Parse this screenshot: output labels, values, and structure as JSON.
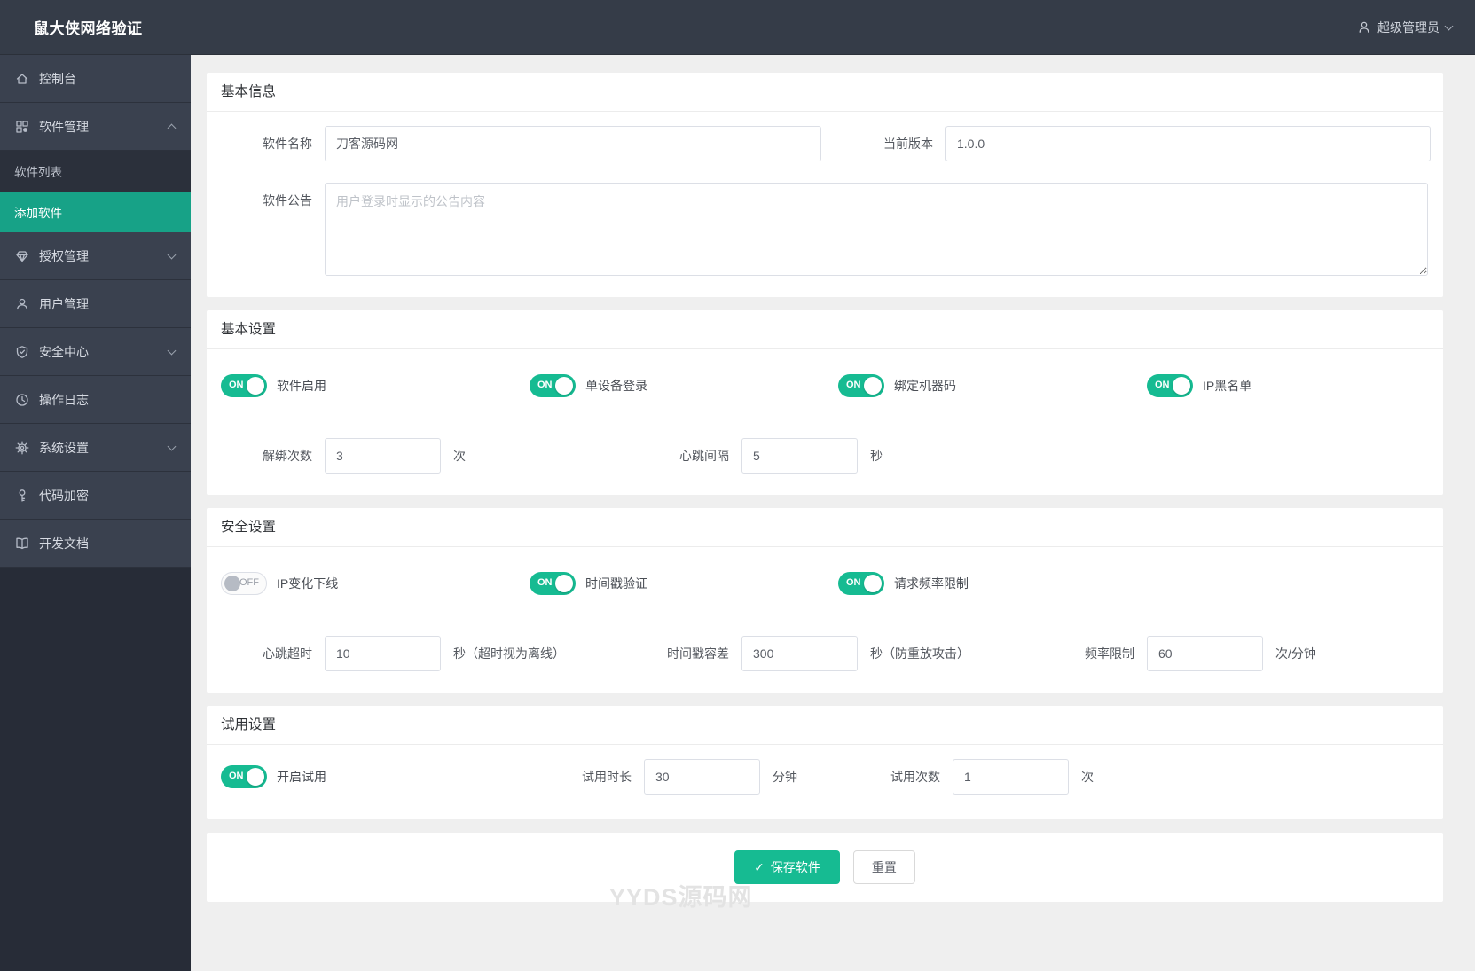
{
  "header": {
    "logo": "鼠大侠网络验证",
    "user": "超级管理员"
  },
  "ui": {
    "on_label": "ON",
    "off_label": "OFF",
    "check_icon": "✓"
  },
  "sidebar": {
    "items": [
      {
        "label": "控制台",
        "icon": "home"
      },
      {
        "label": "软件管理",
        "icon": "apps",
        "expanded": true
      },
      {
        "label": "软件列表",
        "submenu_of": "软件管理"
      },
      {
        "label": "添加软件",
        "submenu_of": "软件管理",
        "active": true
      },
      {
        "label": "授权管理",
        "icon": "gem",
        "expanded": false
      },
      {
        "label": "用户管理",
        "icon": "user"
      },
      {
        "label": "安全中心",
        "icon": "shield",
        "expanded": false
      },
      {
        "label": "操作日志",
        "icon": "clock"
      },
      {
        "label": "系统设置",
        "icon": "gear",
        "expanded": false
      },
      {
        "label": "代码加密",
        "icon": "key"
      },
      {
        "label": "开发文档",
        "icon": "book"
      }
    ]
  },
  "basic_info": {
    "title": "基本信息",
    "name": {
      "label": "软件名称",
      "value": "刀客源码网"
    },
    "version": {
      "label": "当前版本",
      "value": "1.0.0"
    },
    "notice": {
      "label": "软件公告",
      "placeholder": "用户登录时显示的公告内容"
    }
  },
  "basic_settings": {
    "title": "基本设置",
    "toggles": [
      {
        "label": "软件启用",
        "state": "on"
      },
      {
        "label": "单设备登录",
        "state": "on"
      },
      {
        "label": "绑定机器码",
        "state": "on"
      },
      {
        "label": "IP黑名单",
        "state": "on"
      }
    ],
    "unbind": {
      "label": "解绑次数",
      "value": "3",
      "suffix": "次"
    },
    "heartbeat": {
      "label": "心跳间隔",
      "value": "5",
      "suffix": "秒"
    }
  },
  "security_settings": {
    "title": "安全设置",
    "toggles": [
      {
        "label": "IP变化下线",
        "state": "off"
      },
      {
        "label": "时间戳验证",
        "state": "on"
      },
      {
        "label": "请求频率限制",
        "state": "on"
      }
    ],
    "timeout": {
      "label": "心跳超时",
      "value": "10",
      "suffix": "秒（超时视为离线）"
    },
    "tolerance": {
      "label": "时间戳容差",
      "value": "300",
      "suffix": "秒（防重放攻击）"
    },
    "rate": {
      "label": "频率限制",
      "value": "60",
      "suffix": "次/分钟"
    }
  },
  "trial_settings": {
    "title": "试用设置",
    "toggle": {
      "label": "开启试用",
      "state": "on"
    },
    "duration": {
      "label": "试用时长",
      "value": "30",
      "suffix": "分钟"
    },
    "count": {
      "label": "试用次数",
      "value": "1",
      "suffix": "次"
    }
  },
  "actions": {
    "save": "保存软件",
    "reset": "重置"
  },
  "watermark": "YYDS源码网",
  "colors": {
    "accent": "#16bb92",
    "sidebar_active": "#17a287",
    "sidebar_bg": "#3a414f",
    "topbar_bg": "#353c48"
  }
}
